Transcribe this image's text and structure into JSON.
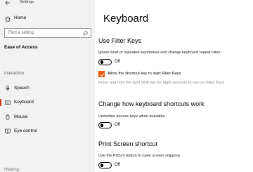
{
  "window": {
    "title": "Settings"
  },
  "sidebar": {
    "home_label": "Home",
    "search_placeholder": "Find a setting",
    "section_heading": "Ease of Access",
    "group_heading": "Interaction",
    "items": [
      {
        "label": "Speech",
        "icon": "speech-icon",
        "active": false
      },
      {
        "label": "Keyboard",
        "icon": "keyboard-icon",
        "active": true
      },
      {
        "label": "Mouse",
        "icon": "mouse-icon",
        "active": false
      },
      {
        "label": "Eye control",
        "icon": "eye-control-icon",
        "active": false
      }
    ],
    "partial_group_heading": "Hearing"
  },
  "main": {
    "page_title": "Keyboard",
    "filter_keys": {
      "title": "Use Filter Keys",
      "description": "Ignore brief or repeated keystrokes and change keyboard repeat rates",
      "toggle_state": "Off",
      "checkbox_label": "Allow the shortcut key to start Filter Keys",
      "checkbox_checked": true,
      "hint": "Press and hold the right Shift key for eight seconds to turn on Filter Keys"
    },
    "shortcuts": {
      "title": "Change how keyboard shortcuts work",
      "description": "Underline access keys when available",
      "toggle_state": "Off"
    },
    "print_screen": {
      "title": "Print Screen shortcut",
      "description": "Use the PrtScn button to open screen snipping",
      "toggle_state": "Off"
    }
  },
  "colors": {
    "accent": "#e8590c",
    "active_bar": "#c83a1e",
    "sidebar_bg": "#f2f2f2"
  }
}
